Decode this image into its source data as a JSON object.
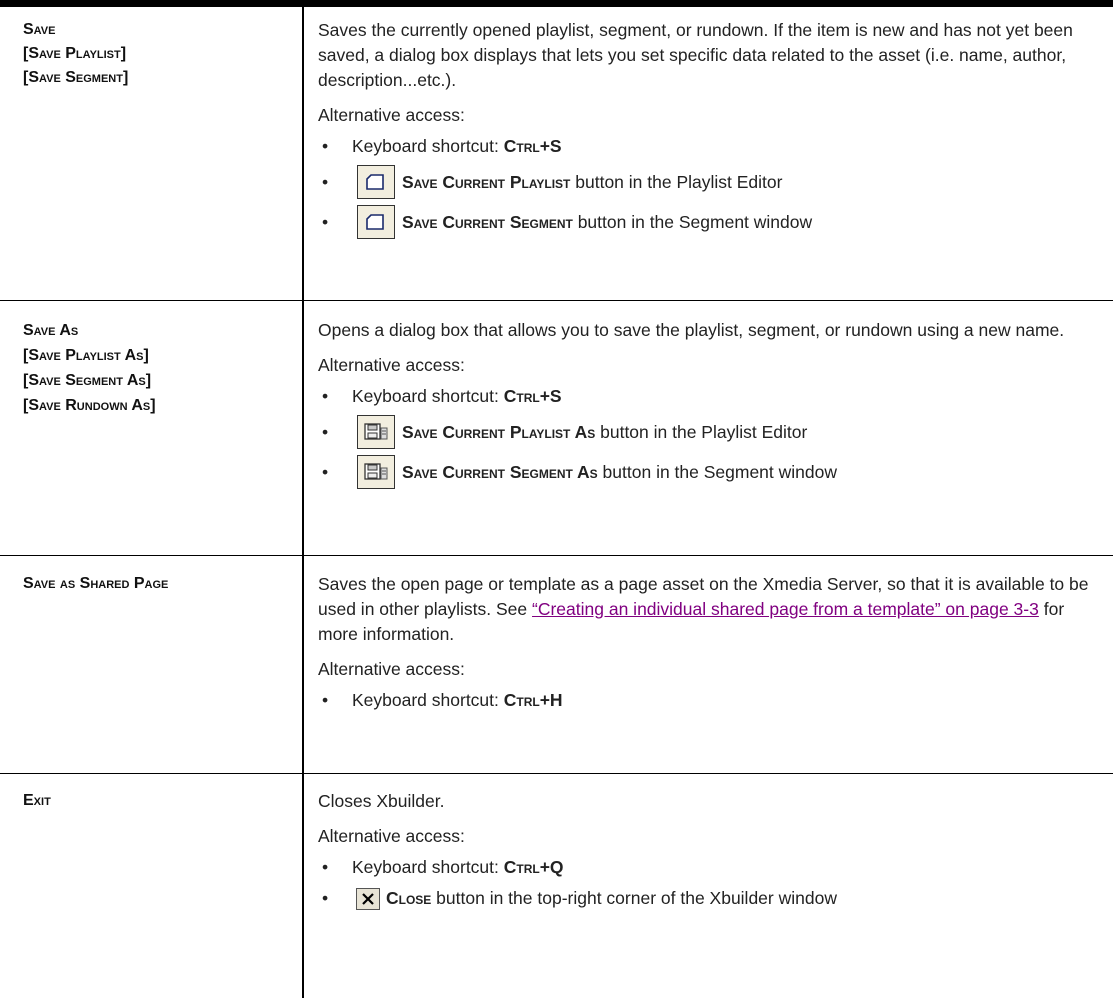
{
  "rows": [
    {
      "labels": [
        "Save",
        "[Save Playlist]",
        "[Save Segment]"
      ],
      "description": "Saves the currently opened playlist, segment, or rundown. If the item is new and has not yet been saved, a dialog box displays that lets you set specific data related to the asset (i.e. name, author, description...etc.).",
      "alt_heading": "Alternative access:",
      "shortcut_prefix": "Keyboard shortcut: ",
      "shortcut": "Ctrl+S",
      "buttons": [
        {
          "icon": "save-page-icon",
          "name": "Save Current Playlist",
          "suffix": " button in the Playlist Editor"
        },
        {
          "icon": "save-page-icon",
          "name": "Save Current Segment",
          "suffix": " button in the Segment window"
        }
      ]
    },
    {
      "labels": [
        "Save As",
        "[Save Playlist As]",
        "[Save Segment As]",
        "[Save Rundown As]"
      ],
      "description": "Opens a dialog box that allows you to save the playlist, segment, or rundown using a new name.",
      "alt_heading": "Alternative access:",
      "shortcut_prefix": "Keyboard shortcut: ",
      "shortcut": "Ctrl+S",
      "buttons": [
        {
          "icon": "floppy-save-as-icon",
          "name": "Save Current Playlist As",
          "suffix": " button in the Playlist Editor"
        },
        {
          "icon": "floppy-save-as-icon",
          "name": "Save Current Segment As",
          "suffix": " button in the Segment window"
        }
      ]
    },
    {
      "labels": [
        "Save as Shared Page"
      ],
      "description_before": "Saves the open page or template as a page asset on the Xmedia Server, so that it is available to be used in other playlists. See ",
      "link_text": "“Creating an individual shared page from a template” on page 3-3",
      "description_after": " for more information.",
      "alt_heading": "Alternative access:",
      "shortcut_prefix": "Keyboard shortcut: ",
      "shortcut": "Ctrl+H"
    },
    {
      "labels": [
        "Exit"
      ],
      "description": "Closes Xbuilder.",
      "alt_heading": "Alternative access:",
      "shortcut_prefix": "Keyboard shortcut: ",
      "shortcut": "Ctrl+Q",
      "buttons": [
        {
          "icon": "close-x-icon",
          "name": "Close",
          "suffix": " button in the top-right corner of the Xbuilder window"
        }
      ]
    }
  ],
  "bullet_char": "•"
}
